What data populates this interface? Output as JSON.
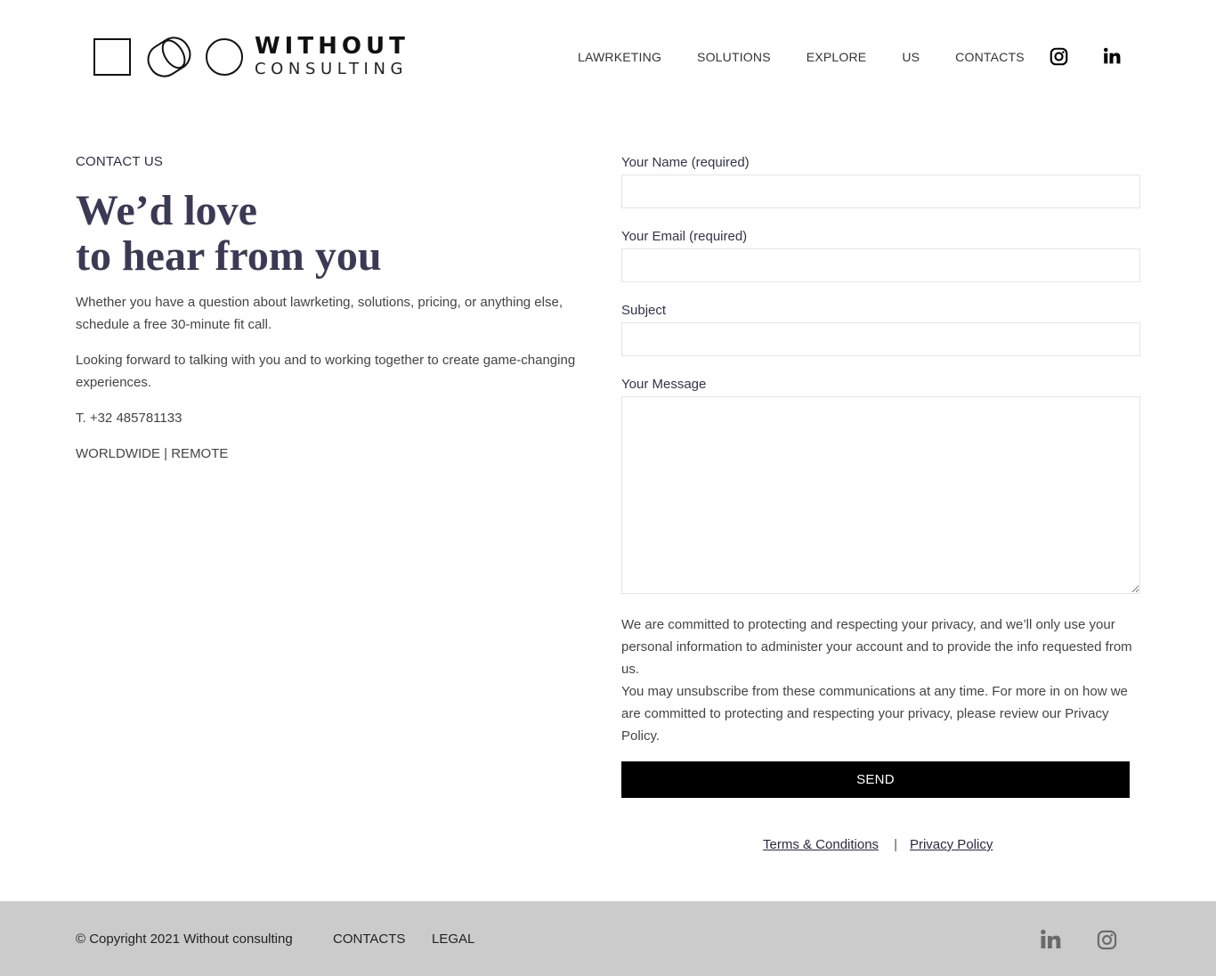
{
  "header": {
    "logo_word1": "WITHOUT",
    "logo_word2": "CONSULTING",
    "nav": [
      "LAWRKETING",
      "SOLUTIONS",
      "EXPLORE",
      "US",
      "CONTACTS"
    ],
    "icons": [
      "instagram-icon",
      "linkedin-icon"
    ]
  },
  "contact": {
    "eyebrow": "CONTACT US",
    "headline_line1": "We’d love",
    "headline_line2": "to hear from you",
    "paragraph1": "Whether you have a question about lawrketing, solutions, pricing, or anything else, schedule a free 30-minute fit call.",
    "paragraph2": "Looking forward to talking with you and to working together to create game-changing experiences.",
    "phone": "T. +32 485781133",
    "location": "WORLDWIDE | REMOTE"
  },
  "form": {
    "name_label": "Your Name (required)",
    "name_value": "",
    "email_label": "Your Email (required)",
    "email_value": "",
    "subject_label": "Subject",
    "subject_value": "",
    "message_label": "Your Message",
    "message_value": "",
    "privacy_text1": "We are committed to protecting and respecting your privacy, and we’ll only use your personal information to administer your account and to provide the info requested from us.",
    "privacy_text2": "You may unsubscribe from these communications at any time. For more in on how we are committed to protecting and respecting your privacy, please review our Privacy Policy.",
    "send_label": "SEND"
  },
  "legal_links": {
    "terms": "Terms & Conditions",
    "separator": "|",
    "privacy": "Privacy Policy"
  },
  "footer": {
    "copyright": "© Copyright 2021 Without consulting",
    "contacts": "CONTACTS",
    "legal": "LEGAL",
    "icons": [
      "linkedin-icon",
      "instagram-icon"
    ],
    "background": "#cbcbcb"
  },
  "colors": {
    "headline": "#3a3a55",
    "button": "#000000",
    "text": "#444444"
  }
}
